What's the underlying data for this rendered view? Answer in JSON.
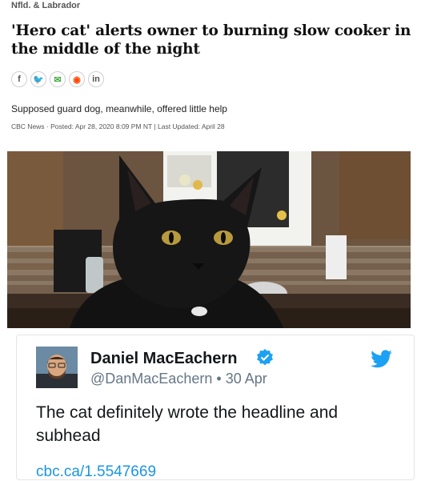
{
  "article": {
    "region": "Nfld. & Labrador",
    "headline": "'Hero cat' alerts owner to burning slow cooker in the middle of the night",
    "share_icons": [
      {
        "name": "facebook-icon",
        "glyph": "f",
        "color": "#555555"
      },
      {
        "name": "twitter-icon",
        "glyph": "🐦",
        "color": "#55acee"
      },
      {
        "name": "email-icon",
        "glyph": "✉",
        "color": "#44aa44"
      },
      {
        "name": "reddit-icon",
        "glyph": "◉",
        "color": "#ff4500"
      },
      {
        "name": "linkedin-icon",
        "glyph": "in",
        "color": "#555555"
      }
    ],
    "subhead": "Supposed guard dog, meanwhile, offered little help",
    "meta": "CBC News · Posted: Apr 28, 2020 8:09 PM NT | Last Updated: April 28"
  },
  "tweet": {
    "name": "Daniel MacEachern",
    "handle": "@DanMacEachern",
    "separator": "•",
    "date": "30 Apr",
    "text": "The cat definitely wrote the headline and subhead",
    "link": "cbc.ca/1.5547669"
  },
  "colors": {
    "twitter_blue": "#1da1f2",
    "link_blue": "#1b95e0",
    "handle_gray": "#657786"
  }
}
